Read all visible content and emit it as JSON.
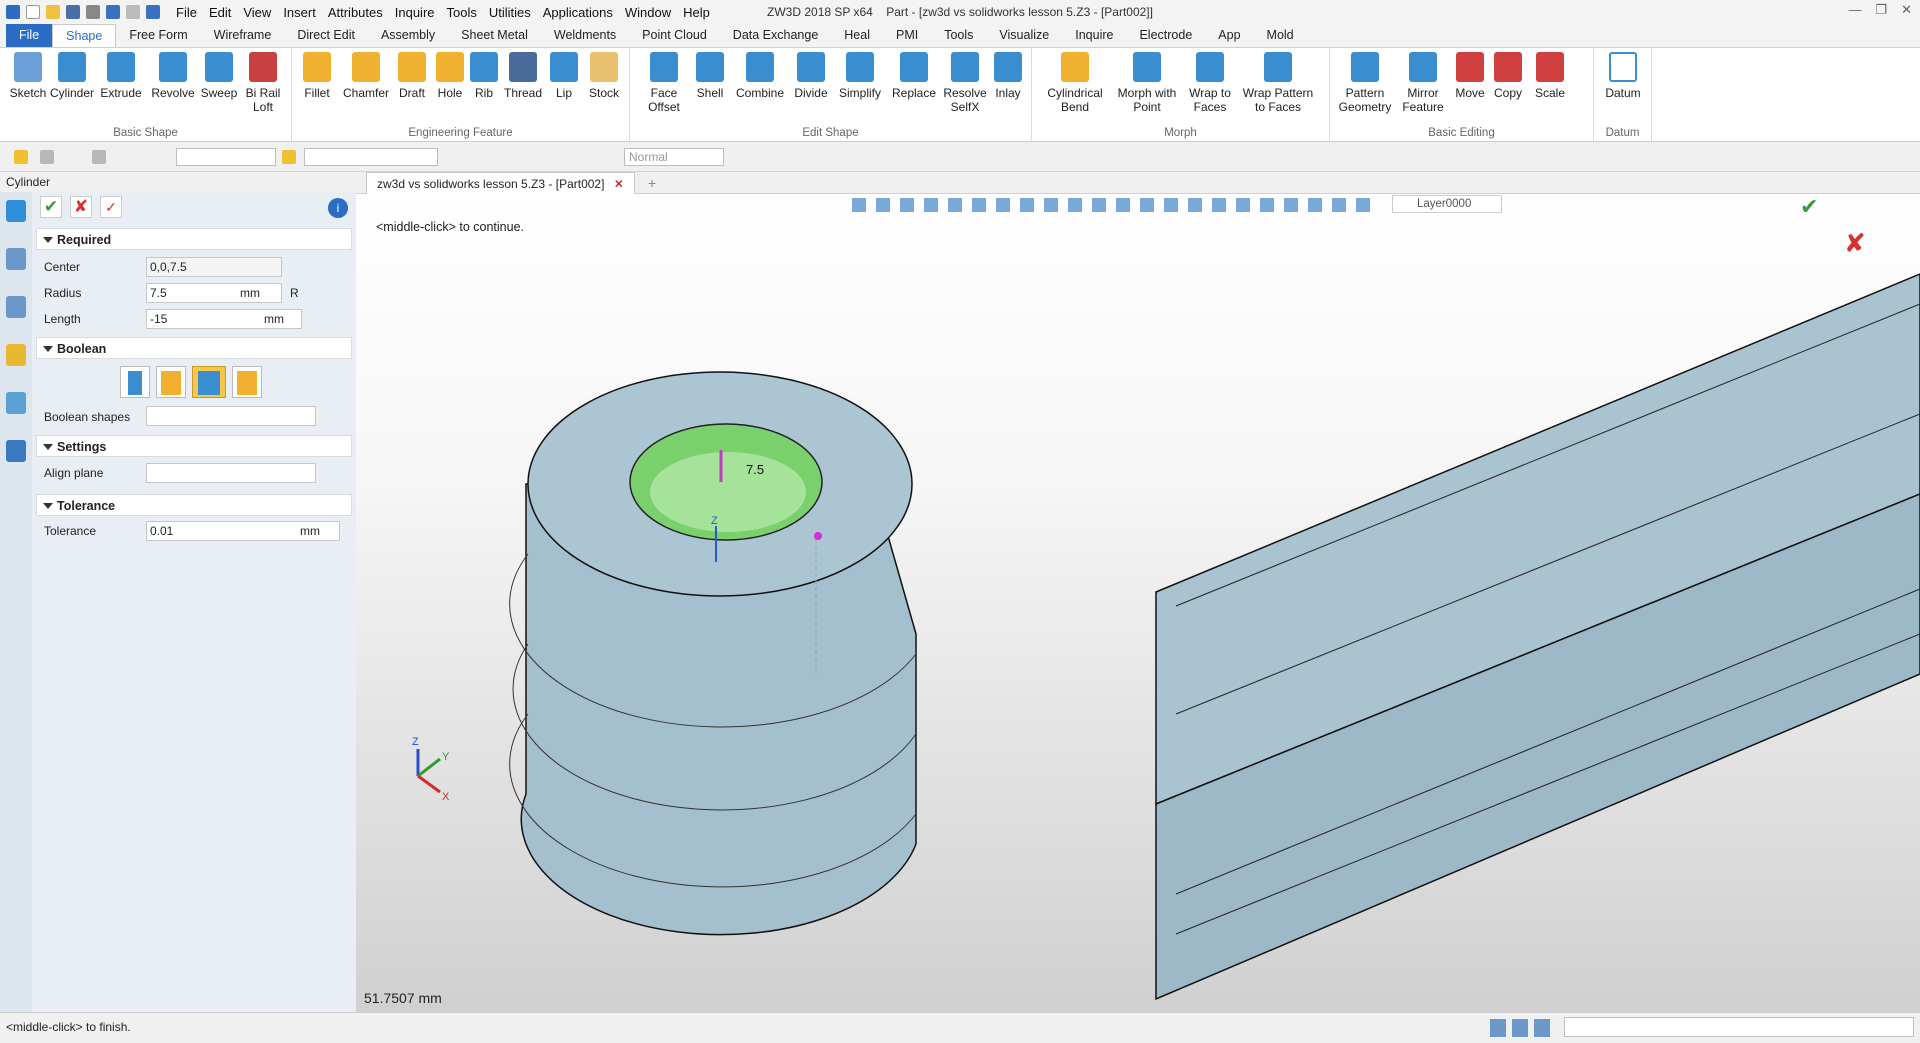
{
  "app": {
    "title": "ZW3D 2018 SP x64",
    "document_title": "Part - [zw3d vs solidworks lesson 5.Z3 - [Part002]]"
  },
  "menu": [
    "File",
    "Edit",
    "View",
    "Insert",
    "Attributes",
    "Inquire",
    "Tools",
    "Utilities",
    "Applications",
    "Window",
    "Help"
  ],
  "tabs": [
    "File",
    "Shape",
    "Free Form",
    "Wireframe",
    "Direct Edit",
    "Assembly",
    "Sheet Metal",
    "Weldments",
    "Point Cloud",
    "Data Exchange",
    "Heal",
    "PMI",
    "Tools",
    "Visualize",
    "Inquire",
    "Electrode",
    "App",
    "Mold"
  ],
  "ribbon": {
    "basic_shape": {
      "label": "Basic Shape",
      "buttons": [
        "Sketch",
        "Cylinder",
        "Extrude",
        "Revolve",
        "Sweep",
        "Bi Rail\nLoft"
      ]
    },
    "engineering": {
      "label": "Engineering Feature",
      "buttons": [
        "Fillet",
        "Chamfer",
        "Draft",
        "Hole",
        "Rib",
        "Thread",
        "Lip",
        "Stock"
      ]
    },
    "edit_shape": {
      "label": "Edit Shape",
      "buttons": [
        "Face\nOffset",
        "Shell",
        "Combine",
        "Divide",
        "Simplify",
        "Replace",
        "Resolve\nSelfX",
        "Inlay"
      ]
    },
    "morph": {
      "label": "Morph",
      "buttons": [
        "Cylindrical\nBend",
        "Morph with\nPoint",
        "Wrap to\nFaces",
        "Wrap Pattern\nto Faces"
      ]
    },
    "basic_editing": {
      "label": "Basic Editing",
      "buttons": [
        "Pattern\nGeometry",
        "Mirror\nFeature",
        "Move",
        "Copy",
        "Scale"
      ]
    },
    "datum": {
      "label": "Datum",
      "buttons": [
        "Datum"
      ]
    }
  },
  "toolbar": {
    "style_combo": "Normal",
    "layer": "Layer0000"
  },
  "panel": {
    "title": "Cylinder",
    "required": {
      "label": "Required",
      "center_label": "Center",
      "center": "0,0,7.5",
      "radius_label": "Radius",
      "radius": "7.5",
      "radius_unit": "mm",
      "radius_flag": "R",
      "length_label": "Length",
      "length": "-15",
      "length_unit": "mm"
    },
    "boolean": {
      "label": "Boolean",
      "shapes_label": "Boolean shapes"
    },
    "settings": {
      "label": "Settings",
      "align_label": "Align plane"
    },
    "tolerance": {
      "label": "Tolerance",
      "tol_label": "Tolerance",
      "tol": "0.01",
      "tol_unit": "mm"
    }
  },
  "doc_tab": "zw3d vs solidworks lesson 5.Z3 - [Part002]",
  "viewport": {
    "prompt": "<middle-click> to continue.",
    "radius_dim": "7.5",
    "readout": "51.7507 mm",
    "axes": {
      "x": "X",
      "y": "Y",
      "z": "Z"
    }
  },
  "status": {
    "text": "<middle-click> to finish."
  },
  "colors": {
    "accent": "#2b6cc4",
    "part": "#a7c1cf",
    "cylinder": "#a6e39a",
    "ok": "#3a9b3a",
    "cancel": "#d53030"
  }
}
